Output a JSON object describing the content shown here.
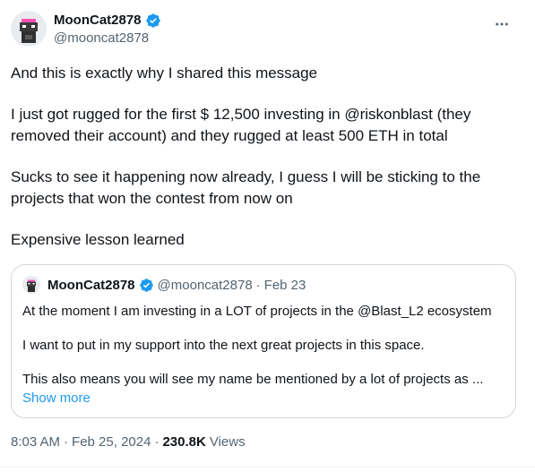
{
  "author": {
    "display_name": "MoonCat2878",
    "handle": "@mooncat2878"
  },
  "tweet": {
    "paragraphs": [
      "And this is exactly why I shared this message",
      "I just got rugged for the first $ 12,500 investing in @riskonblast (they removed their account) and they rugged at least 500 ETH in total",
      "Sucks to see it happening now already, I guess I will be sticking to the projects that won the contest from now on",
      "Expensive lesson learned"
    ]
  },
  "quoted": {
    "display_name": "MoonCat2878",
    "handle": "@mooncat2878",
    "separator": "·",
    "date": "Feb 23",
    "paragraphs": [
      "At the moment I am investing in a LOT of projects in the @Blast_L2 ecosystem",
      "I want to put in my support into the next great projects in this space.",
      "This also means you will see my name be mentioned by a lot of projects as ..."
    ],
    "show_more": "Show more"
  },
  "meta": {
    "time": "8:03 AM",
    "separator1": "·",
    "date": "Feb 25, 2024",
    "separator2": "·",
    "views_count": "230.8K",
    "views_label": "Views"
  },
  "icons": {
    "verified": "verified-badge-icon",
    "more": "more-horizontal-icon"
  },
  "colors": {
    "accent": "#1d9bf0",
    "secondary_text": "#536471",
    "text": "#0f1419",
    "border": "#cfd9de"
  }
}
